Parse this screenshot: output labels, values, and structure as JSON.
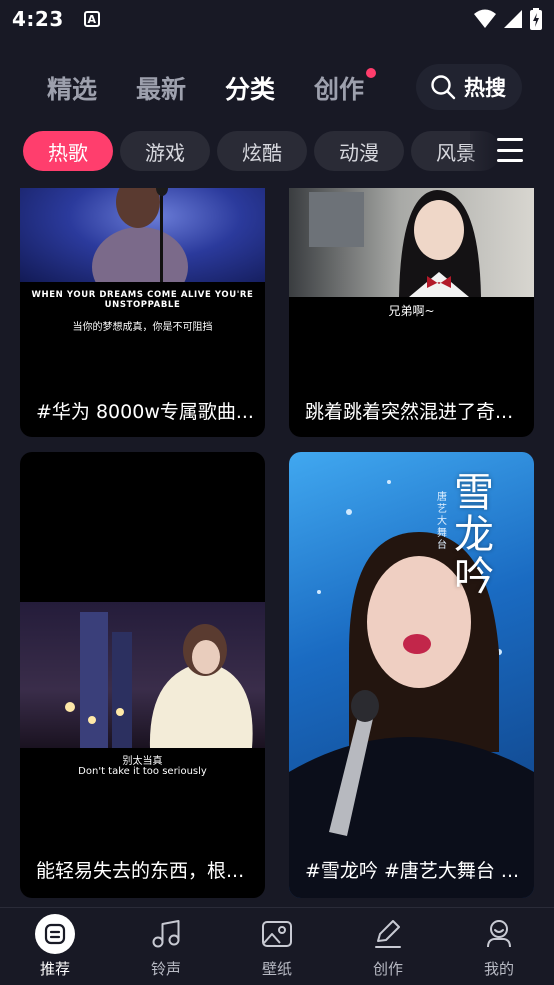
{
  "status": {
    "time": "4:23",
    "notif_letter": "A"
  },
  "topnav": {
    "tabs": [
      {
        "label": "精选",
        "active": false
      },
      {
        "label": "最新",
        "active": false
      },
      {
        "label": "分类",
        "active": true
      },
      {
        "label": "创作",
        "active": false,
        "dot": true
      }
    ],
    "search_label": "热搜"
  },
  "categories": [
    "热歌",
    "游戏",
    "炫酷",
    "动漫",
    "风景"
  ],
  "cards": [
    {
      "title": "#华为 8000w专属歌曲...",
      "caption_en": "WHEN YOUR DREAMS COME ALIVE YOU'RE UNSTOPPABLE",
      "caption_cn": "当你的梦想成真，你是不可阻挡"
    },
    {
      "title": "跳着跳着突然混进了奇...",
      "caption_cn": "兄弟啊~"
    },
    {
      "title": "能轻易失去的东西，根...",
      "caption_cn": "别太当真",
      "caption_en": "Don't take it too seriously"
    },
    {
      "title": "#雪龙吟 #唐艺大舞台 ...",
      "art_text": "雪龙吟",
      "art_sub": "唐艺大舞台"
    }
  ],
  "bottomnav": [
    {
      "label": "推荐",
      "icon": "recommend-icon",
      "active": true
    },
    {
      "label": "铃声",
      "icon": "music-note-icon",
      "active": false
    },
    {
      "label": "壁纸",
      "icon": "image-icon",
      "active": false
    },
    {
      "label": "创作",
      "icon": "pencil-icon",
      "active": false
    },
    {
      "label": "我的",
      "icon": "profile-icon",
      "active": false
    }
  ],
  "colors": {
    "background": "#181925",
    "accent": "#ff3e6d",
    "chip": "#2a2b36"
  }
}
